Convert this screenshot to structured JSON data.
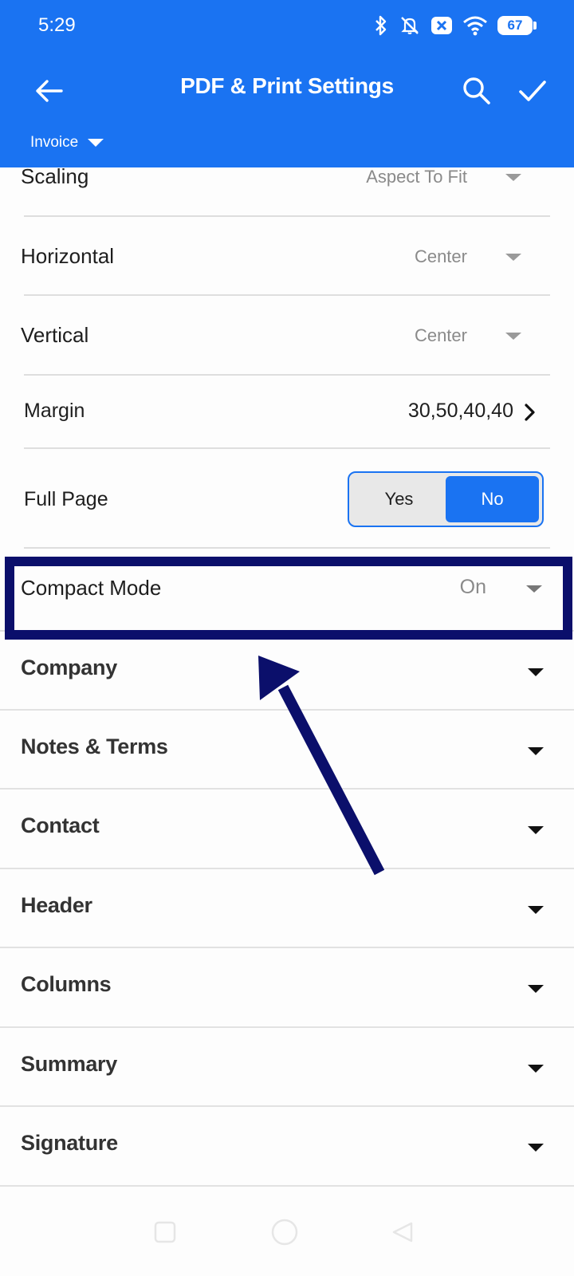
{
  "status_bar": {
    "time": "5:29",
    "battery": "67",
    "icons": [
      "bluetooth-icon",
      "mute-icon",
      "notification-icon",
      "wifi-icon",
      "battery-icon"
    ]
  },
  "app_bar": {
    "title": "PDF & Print Settings",
    "document_type": "Invoice",
    "actions": [
      "back-icon",
      "search-icon",
      "check-icon"
    ],
    "color": "#1a73f2"
  },
  "settings": {
    "scaling": {
      "label": "Scaling",
      "value": "Aspect To Fit"
    },
    "horizontal": {
      "label": "Horizontal",
      "value": "Center"
    },
    "vertical": {
      "label": "Vertical",
      "value": "Center"
    },
    "margin": {
      "label": "Margin",
      "value": "30,50,40,40"
    },
    "full_page": {
      "label": "Full Page",
      "options": [
        "Yes",
        "No"
      ],
      "selected": "No"
    },
    "compact_mode": {
      "label": "Compact Mode",
      "value": "On"
    }
  },
  "sections": [
    {
      "label": "Company"
    },
    {
      "label": "Notes & Terms"
    },
    {
      "label": "Contact"
    },
    {
      "label": "Header"
    },
    {
      "label": "Columns"
    },
    {
      "label": "Summary"
    },
    {
      "label": "Signature"
    }
  ],
  "annotation": {
    "highlighted_item": "Compact Mode",
    "color": "#0b0f6b"
  },
  "nav_bar": [
    "recents-icon",
    "home-icon",
    "back-nav-icon"
  ]
}
